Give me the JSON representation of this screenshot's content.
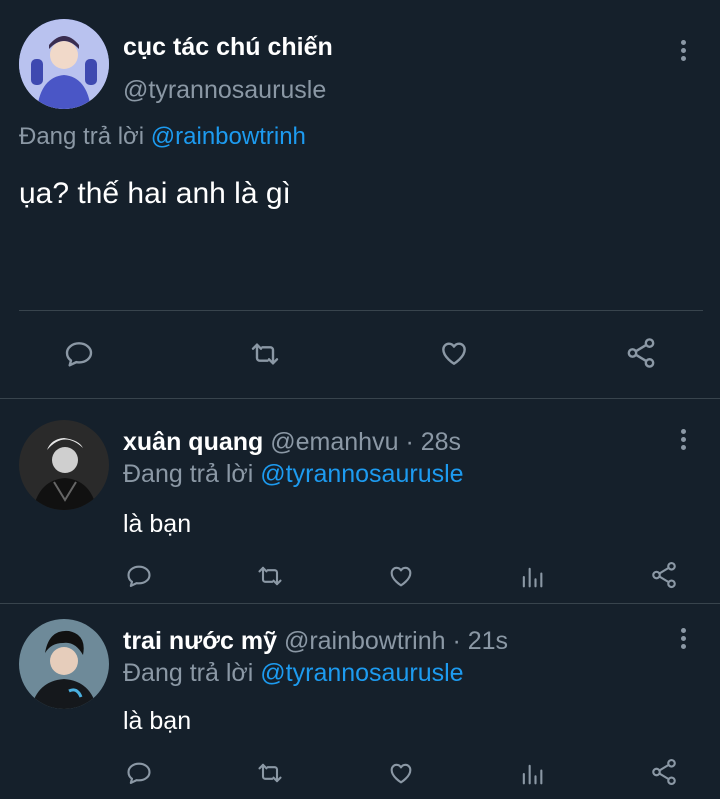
{
  "main_tweet": {
    "display_name": "cục tác chú chiến",
    "handle": "@tyrannosaurusle",
    "replying_prefix": "Đang trả lời",
    "replying_to": "@rainbowtrinh",
    "text": "ụa? thế hai anh là gì",
    "icons": [
      "reply-icon",
      "retweet-icon",
      "like-icon",
      "share-icon"
    ]
  },
  "replies": [
    {
      "display_name": "xuân quang",
      "handle": "@emanhvu",
      "time": "· 28s",
      "replying_prefix": "Đang trả lời",
      "replying_to": "@tyrannosaurusle",
      "text": "là bạn"
    },
    {
      "display_name": "trai nước mỹ",
      "handle": "@rainbowtrinh",
      "time": "· 21s",
      "replying_prefix": "Đang trả lời",
      "replying_to": "@tyrannosaurusle",
      "text": "là bạn"
    }
  ],
  "colors": {
    "background": "#15202b",
    "text": "#ffffff",
    "muted": "#8b98a5",
    "link": "#1d9bf0",
    "divider": "#38444d"
  }
}
